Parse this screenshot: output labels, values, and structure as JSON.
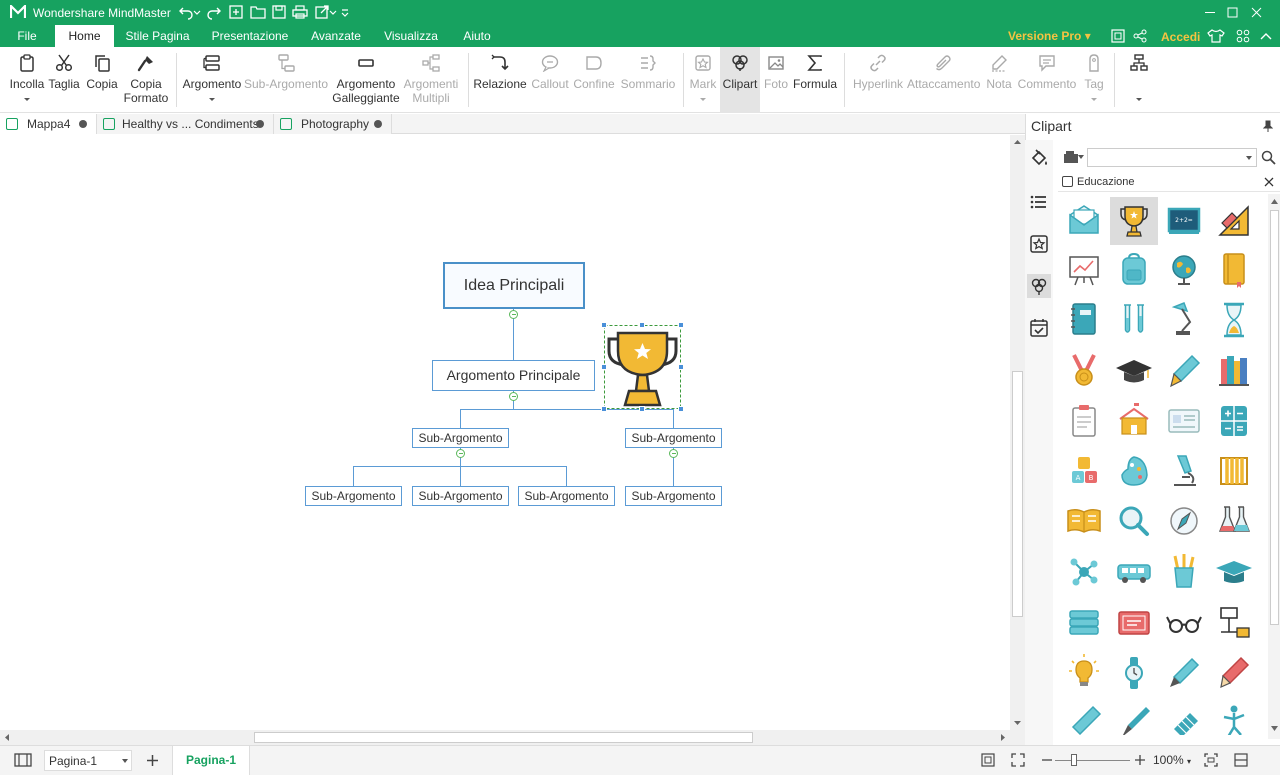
{
  "app": {
    "title": "Wondershare MindMaster",
    "colors": {
      "brand": "#17a260",
      "accent_gold": "#f5c342",
      "node_border": "#5b9bd5"
    }
  },
  "menu": {
    "tabs": [
      "File",
      "Home",
      "Stile Pagina",
      "Presentazione",
      "Avanzate",
      "Visualizza",
      "Aiuto"
    ],
    "active": "Home",
    "pro_label": "Versione Pro",
    "login_label": "Accedi"
  },
  "ribbon": {
    "incolla": "Incolla",
    "taglia": "Taglia",
    "copia": "Copia",
    "copia_formato_1": "Copia",
    "copia_formato_2": "Formato",
    "argomento": "Argomento",
    "sub_argomento": "Sub-Argomento",
    "argomento_gall_1": "Argomento",
    "argomento_gall_2": "Galleggiante",
    "argomenti_multipli_1": "Argomenti",
    "argomenti_multipli_2": "Multipli",
    "relazione": "Relazione",
    "callout": "Callout",
    "confine": "Confine",
    "sommario": "Sommario",
    "mark": "Mark",
    "clipart": "Clipart",
    "foto": "Foto",
    "formula": "Formula",
    "hyperlink": "Hyperlink",
    "attaccamento": "Attaccamento",
    "nota": "Nota",
    "commento": "Commento",
    "tag": "Tag"
  },
  "doc_tabs": [
    "Mappa4",
    "Healthy vs ... Condiments",
    "Photography"
  ],
  "mindmap": {
    "central": "Idea Principali",
    "main_topic": "Argomento Principale",
    "subtopics": [
      "Sub-Argomento",
      "Sub-Argomento"
    ],
    "subsubtopics": [
      "Sub-Argomento",
      "Sub-Argomento",
      "Sub-Argomento",
      "Sub-Argomento"
    ]
  },
  "panel": {
    "title": "Clipart",
    "search_value": "",
    "category": "Educazione",
    "icons": [
      "mail-icon",
      "trophy-icon",
      "blackboard-icon",
      "ruler-triangle-icon",
      "presentation-chart-icon",
      "backpack-icon",
      "globe-icon",
      "notebook-icon",
      "binder-icon",
      "test-tubes-icon",
      "desk-lamp-icon",
      "hourglass-icon",
      "medal-icon",
      "graduation-cap-icon",
      "fountain-pen-icon",
      "books-icon",
      "clipboard-icon",
      "school-icon",
      "id-card-icon",
      "calculator-icon",
      "abc-blocks-icon",
      "palette-icon",
      "microscope-icon",
      "abacus-icon",
      "open-book-icon",
      "magnifier-icon",
      "compass-icon",
      "flasks-icon",
      "molecule-icon",
      "school-bus-icon",
      "pencil-cup-icon",
      "mortarboard-icon",
      "book-stack-icon",
      "certificate-icon",
      "glasses-icon",
      "flowchart-icon",
      "light-bulb-icon",
      "watch-icon",
      "pen-nib-icon",
      "pencil-icon",
      "pencil-slant-icon",
      "brush-icon",
      "comb-icon",
      "dancer-icon"
    ],
    "selected_icon": "trophy-icon"
  },
  "status": {
    "page_select": "Pagina-1",
    "page_tab": "Pagina-1",
    "zoom": "100%"
  }
}
